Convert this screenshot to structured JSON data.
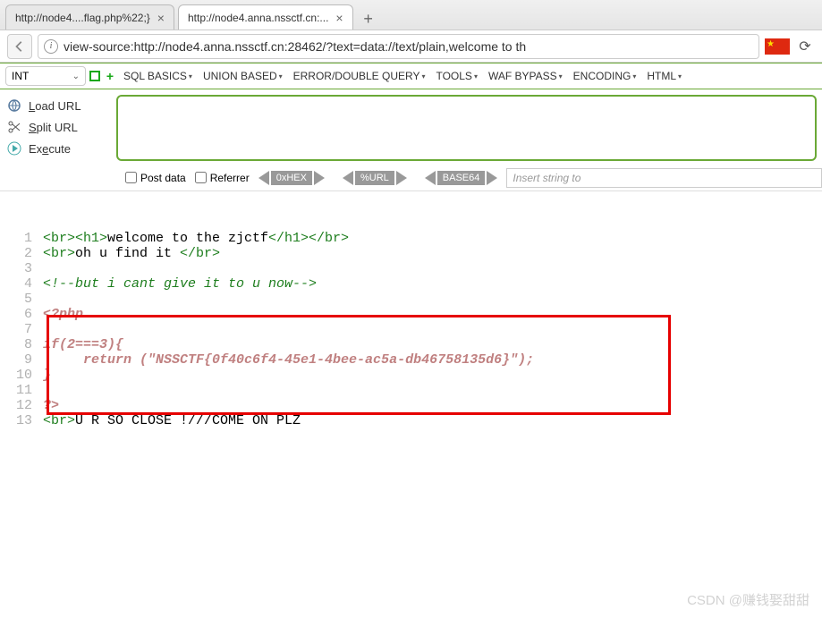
{
  "tabs": [
    {
      "title": "http://node4....flag.php%22;}",
      "active": false
    },
    {
      "title": "http://node4.anna.nssctf.cn:...",
      "active": true
    }
  ],
  "address": {
    "url": "view-source:http://node4.anna.nssctf.cn:28462/?text=data://text/plain,welcome to th"
  },
  "toolbar": {
    "intLabel": "INT",
    "items": [
      "SQL BASICS",
      "UNION BASED",
      "ERROR/DOUBLE QUERY",
      "TOOLS",
      "WAF BYPASS",
      "ENCODING",
      "HTML"
    ]
  },
  "leftActions": {
    "load": "oad URL",
    "loadAccel": "L",
    "split": "plit URL",
    "splitAccel": "S",
    "execute": "ecute",
    "executeAccel": "Ex"
  },
  "options": {
    "post": "Post data",
    "ref": "Referrer",
    "pills": [
      "0xHEX",
      "%URL",
      "BASE64"
    ],
    "insertPlaceholder": "Insert string to"
  },
  "code": {
    "lines": [
      {
        "n": 1,
        "segs": [
          [
            "tag",
            "<br><h1>"
          ],
          [
            "txt",
            "welcome to the zjctf"
          ],
          [
            "tag",
            "</h1></br>"
          ]
        ]
      },
      {
        "n": 2,
        "segs": [
          [
            "tag",
            "<br>"
          ],
          [
            "txt",
            "oh u find it "
          ],
          [
            "tag",
            "</br>"
          ]
        ]
      },
      {
        "n": 3,
        "segs": []
      },
      {
        "n": 4,
        "segs": [
          [
            "comment",
            "<!--but i cant give it to u now-->"
          ]
        ]
      },
      {
        "n": 5,
        "segs": []
      },
      {
        "n": 6,
        "segs": [
          [
            "php",
            "<?php"
          ]
        ]
      },
      {
        "n": 7,
        "segs": []
      },
      {
        "n": 8,
        "segs": [
          [
            "php",
            "if(2===3){ "
          ]
        ]
      },
      {
        "n": 9,
        "segs": [
          [
            "php",
            "     return (\"NSSCTF{0f40c6f4-45e1-4bee-ac5a-db46758135d6}\");"
          ]
        ]
      },
      {
        "n": 10,
        "segs": [
          [
            "php",
            "}"
          ]
        ]
      },
      {
        "n": 11,
        "segs": []
      },
      {
        "n": 12,
        "segs": [
          [
            "php",
            "?>"
          ]
        ]
      },
      {
        "n": 13,
        "segs": [
          [
            "tag",
            "<br>"
          ],
          [
            "txt",
            "U R SO CLOSE !///COME ON PLZ"
          ]
        ]
      }
    ]
  },
  "watermark": "CSDN @赚钱娶甜甜"
}
